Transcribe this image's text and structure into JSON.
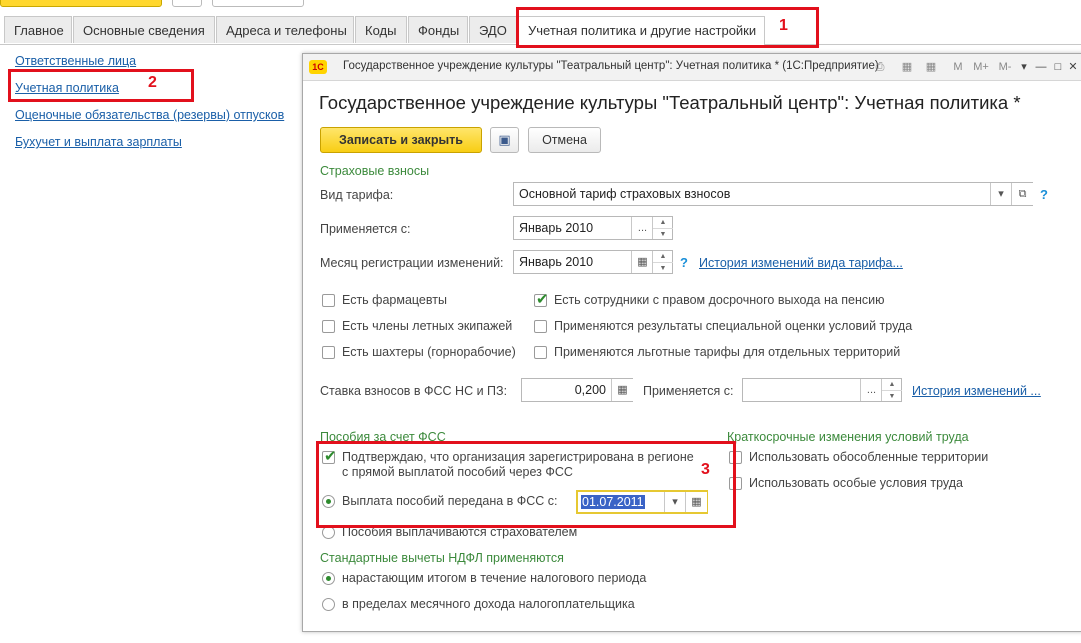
{
  "tabs": [
    {
      "label": "Главное",
      "active": false
    },
    {
      "label": "Основные сведения",
      "active": false
    },
    {
      "label": "Адреса и телефоны",
      "active": false
    },
    {
      "label": "Коды",
      "active": false
    },
    {
      "label": "Фонды",
      "active": false
    },
    {
      "label": "ЭДО",
      "active": false
    },
    {
      "label": "Учетная политика и другие настройки",
      "active": true
    }
  ],
  "left_nav": [
    "Ответственные лица",
    "Учетная политика",
    "Оценочные обязательства (резервы) отпусков",
    "Бухучет и выплата зарплаты"
  ],
  "annotations": [
    "1",
    "2",
    "3"
  ],
  "dialog": {
    "title": "Государственное учреждение культуры \"Театральный центр\": Учетная политика * (1С:Предприятие)",
    "logo": "1С",
    "toolbar_icons": [
      "print-icon",
      "calculator-icon",
      "calendar-icon",
      "M",
      "M+",
      "M-",
      "menu-icon",
      "minimize-icon",
      "maximize-icon",
      "close-icon"
    ],
    "heading": "Государственное учреждение культуры \"Театральный центр\": Учетная политика *",
    "buttons": {
      "save_close": "Записать и закрыть",
      "cancel": "Отмена"
    },
    "insurance": {
      "section": "Страховые взносы",
      "tariff_label": "Вид тарифа:",
      "tariff_value": "Основной тариф страховых взносов",
      "applies_label": "Применяется с:",
      "applies_value": "Январь 2010",
      "reg_month_label": "Месяц регистрации изменений:",
      "reg_month_value": "Январь 2010",
      "history_tariff_link": "История изменений вида тарифа...",
      "help": "?"
    },
    "checks_left": [
      {
        "label": "Есть фармацевты",
        "checked": false
      },
      {
        "label": "Есть члены летных экипажей",
        "checked": false
      },
      {
        "label": "Есть шахтеры (горнорабочие)",
        "checked": false
      }
    ],
    "checks_right": [
      {
        "label": "Есть сотрудники с правом досрочного выхода на пенсию",
        "checked": true
      },
      {
        "label": "Применяются результаты специальной оценки условий труда",
        "checked": false
      },
      {
        "label": "Применяются льготные тарифы для отдельных территорий",
        "checked": false
      }
    ],
    "fss_rate": {
      "label": "Ставка взносов в ФСС НС и ПЗ:",
      "value": "0,200",
      "applies_label": "Применяется с:",
      "applies_value": "",
      "history_link": "История изменений ..."
    },
    "benefits": {
      "section": "Пособия за счет ФСС",
      "confirm_label_1": "Подтверждаю, что организация зарегистрирована в регионе",
      "confirm_label_2": "с прямой выплатой пособий через ФСС",
      "confirm_checked": true,
      "option_fss_label": "Выплата пособий передана в ФСС с:",
      "option_fss_date": "01.07.2011",
      "option_employer_label": "Пособия выплачиваются страхователем"
    },
    "short_term": {
      "section": "Краткосрочные изменения условий труда",
      "items": [
        {
          "label": "Использовать обособленные территории",
          "checked": false
        },
        {
          "label": "Использовать особые условия труда",
          "checked": false
        }
      ]
    },
    "ndfl": {
      "section": "Стандартные вычеты НДФЛ применяются",
      "options": [
        {
          "label": "нарастающим итогом в течение налогового периода",
          "selected": true
        },
        {
          "label": "в пределах месячного дохода налогоплательщика",
          "selected": false
        }
      ]
    }
  }
}
